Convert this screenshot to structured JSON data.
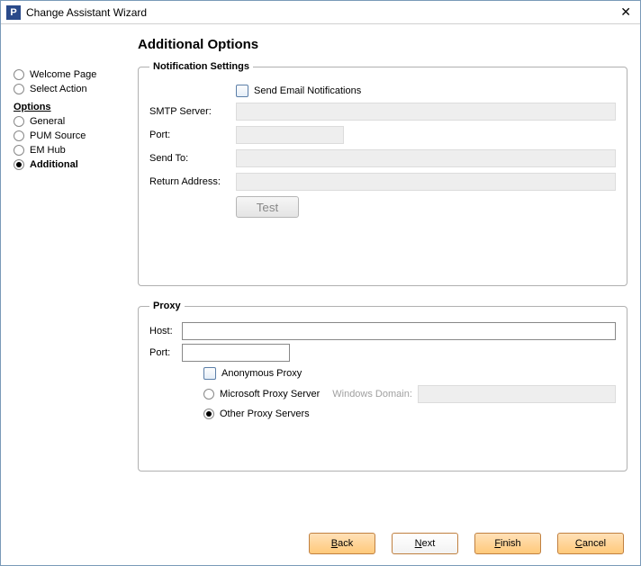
{
  "window": {
    "title": "Change Assistant Wizard",
    "app_icon_letter": "P"
  },
  "sidebar": {
    "items_top": [
      {
        "label": "Welcome Page",
        "selected": false
      },
      {
        "label": "Select Action",
        "selected": false
      }
    ],
    "options_heading": "Options",
    "items_options": [
      {
        "label": "General",
        "selected": false
      },
      {
        "label": "PUM Source",
        "selected": false
      },
      {
        "label": "EM Hub",
        "selected": false
      },
      {
        "label": "Additional",
        "selected": true
      }
    ]
  },
  "page": {
    "title": "Additional Options"
  },
  "notification": {
    "legend": "Notification Settings",
    "send_email_label": "Send Email Notifications",
    "smtp_label": "SMTP Server:",
    "port_label": "Port:",
    "sendto_label": "Send To:",
    "return_label": "Return Address:",
    "test_label": "Test",
    "smtp_value": "",
    "port_value": "",
    "sendto_value": "",
    "return_value": ""
  },
  "proxy": {
    "legend": "Proxy",
    "host_label": "Host:",
    "port_label": "Port:",
    "host_value": "",
    "port_value": "",
    "anon_label": "Anonymous Proxy",
    "ms_label": "Microsoft Proxy Server",
    "windows_domain_label": "Windows Domain:",
    "windows_domain_value": "",
    "other_label": "Other Proxy Servers",
    "selected": "other"
  },
  "footer": {
    "back": "Back",
    "next": "Next",
    "finish": "Finish",
    "cancel": "Cancel"
  }
}
